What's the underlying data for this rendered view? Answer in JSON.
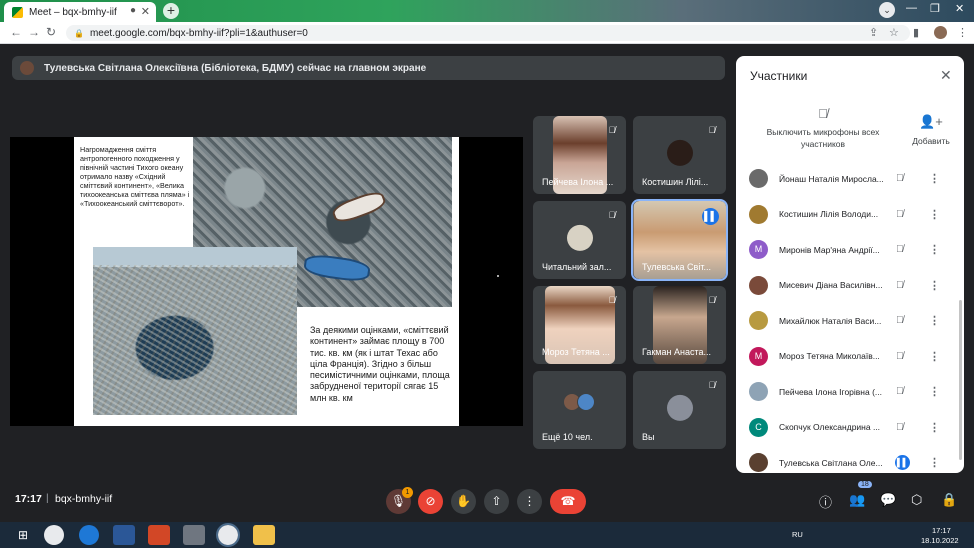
{
  "browser": {
    "tab_title": "Meet – bqx-bmhy-iif",
    "url": "meet.google.com/bqx-bmhy-iif?pli=1&authuser=0"
  },
  "banner": {
    "text": "Тулевська Світлана Олексіївна (Бібліотека, БДМУ) сейчас на главном экране"
  },
  "slide": {
    "text1": "Нагромадження сміття антропогенного походження у північній частині Тихого океану отримало назву «Східний сміттєвий континент», «Велика тихоокеанська сміттєва пляма» і «Тихоокеанський сміттєворот».",
    "text2": "За деякими оцінками, «сміттєвий континент» займає площу в 700 тис. кв. км (як і штат Техас або ціла Франція). Згідно з більш песимістичними оцінками, площа забрудненої території сягає 15 млн кв. км"
  },
  "tiles": [
    {
      "name": "Пейчева Ілона ..."
    },
    {
      "name": "Костишин Лілі..."
    },
    {
      "name": "Читальний зал..."
    },
    {
      "name": "Тулевська Світ..."
    },
    {
      "name": "Мороз Тетяна ..."
    },
    {
      "name": "Гакман Анаста..."
    },
    {
      "name": "Ещё 10 чел."
    },
    {
      "name": "Вы"
    }
  ],
  "bottom": {
    "time": "17:17",
    "meeting_code": "bqx-bmhy-iif",
    "mic_badge": "1",
    "participants_count": "18"
  },
  "panel": {
    "title": "Участники",
    "mute_all": "Выключить микрофоны всех участников",
    "add": "Добавить",
    "participants": [
      {
        "name": "Йонаш Наталія Миросла...",
        "initial": "",
        "color": "#6a6a6a"
      },
      {
        "name": "Костишин Лілія Володи...",
        "initial": "",
        "color": "#a07a30"
      },
      {
        "name": "Миронів Мар'яна Андрії...",
        "initial": "M",
        "color": "#8e5cc9"
      },
      {
        "name": "Мисевич Діана Василівн...",
        "initial": "",
        "color": "#7a4a3a"
      },
      {
        "name": "Михайлюк Наталія Васи...",
        "initial": "",
        "color": "#b89a40"
      },
      {
        "name": "Мороз Тетяна Миколаїв...",
        "initial": "M",
        "color": "#c2185b"
      },
      {
        "name": "Пейчева Ілона Ігорівна (...",
        "initial": "",
        "color": "#8ea3b5"
      },
      {
        "name": "Скопчук Олександрина ...",
        "initial": "C",
        "color": "#00897b"
      },
      {
        "name": "Тулевська Світлана Оле...",
        "initial": "",
        "color": "#5a4030"
      }
    ]
  },
  "taskbar": {
    "lang": "RU",
    "time": "17:17",
    "date": "18.10.2022"
  }
}
